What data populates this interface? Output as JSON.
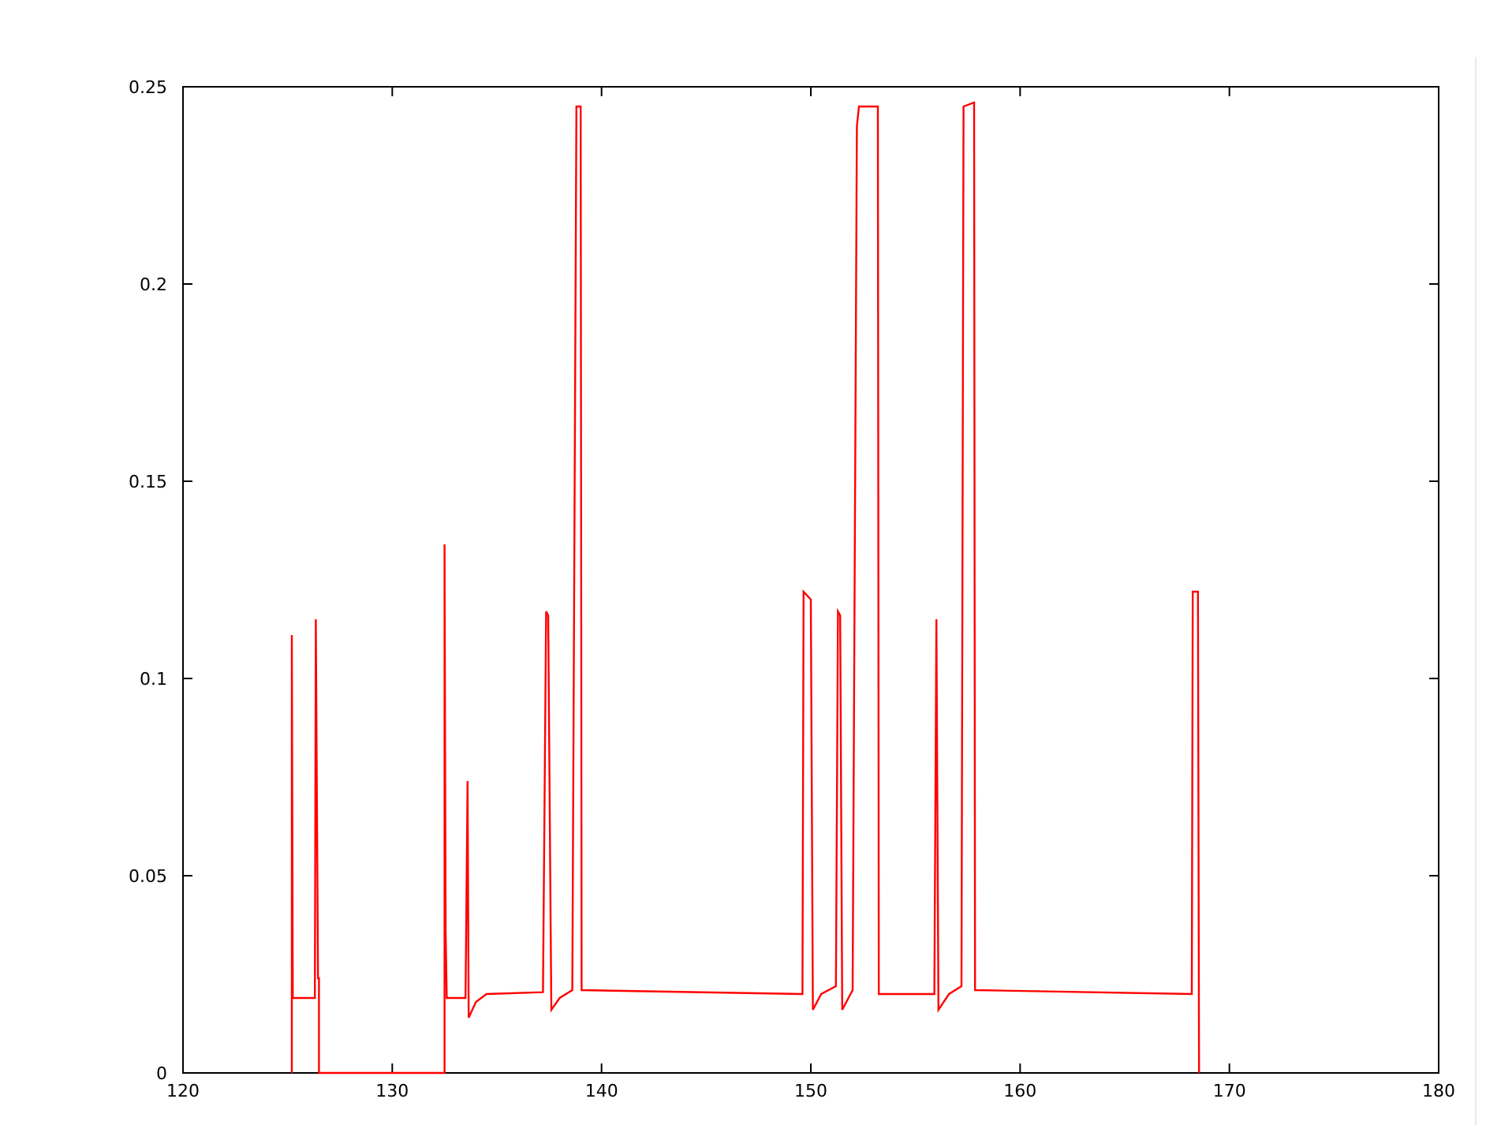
{
  "plot": {
    "chart_data": {
      "type": "line",
      "xlim": [
        120,
        180
      ],
      "ylim": [
        0,
        0.25
      ],
      "xticks": [
        120,
        130,
        140,
        150,
        160,
        170,
        180
      ],
      "yticks": [
        {
          "value": 0,
          "label": "0"
        },
        {
          "value": 0.05,
          "label": "0.05"
        },
        {
          "value": 0.1,
          "label": "0.1"
        },
        {
          "value": 0.15,
          "label": "0.15"
        },
        {
          "value": 0.2,
          "label": "0.2"
        },
        {
          "value": 0.25,
          "label": "0.25"
        }
      ],
      "x": [
        125.2,
        125.2,
        125.25,
        126.3,
        126.35,
        126.45,
        126.5,
        126.5,
        132.5,
        132.5,
        132.55,
        132.6,
        133.5,
        133.6,
        133.65,
        134.0,
        134.5,
        137.2,
        137.35,
        137.45,
        137.6,
        138.0,
        138.6,
        138.8,
        139.0,
        139.05,
        149.6,
        149.65,
        150.0,
        150.1,
        150.5,
        151.2,
        151.3,
        151.4,
        151.5,
        152.0,
        152.2,
        152.3,
        153.2,
        153.25,
        155.9,
        156.0,
        156.1,
        156.6,
        157.2,
        157.3,
        157.8,
        157.85,
        168.2,
        168.25,
        168.5,
        168.55
      ],
      "series": [
        {
          "color": "#ff0000",
          "values": [
            0,
            0.111,
            0.019,
            0.019,
            0.115,
            0.024,
            0.024,
            0,
            0,
            0.134,
            0.036,
            0.019,
            0.019,
            0.074,
            0.014,
            0.018,
            0.02,
            0.0205,
            0.117,
            0.116,
            0.016,
            0.019,
            0.021,
            0.245,
            0.245,
            0.021,
            0.02,
            0.122,
            0.12,
            0.016,
            0.02,
            0.022,
            0.117,
            0.116,
            0.016,
            0.021,
            0.24,
            0.245,
            0.245,
            0.02,
            0.02,
            0.115,
            0.016,
            0.02,
            0.022,
            0.245,
            0.246,
            0.021,
            0.02,
            0.122,
            0.122,
            0
          ]
        }
      ]
    }
  }
}
